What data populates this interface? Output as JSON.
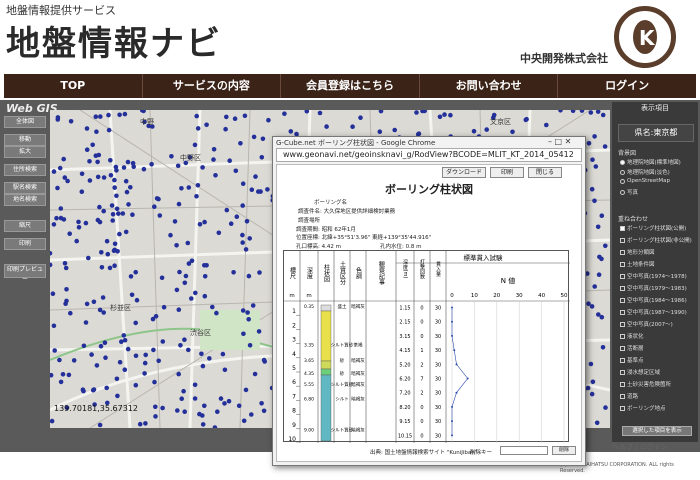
{
  "header": {
    "subtitle": "地盤情報提供サービス",
    "title": "地盤情報ナビ",
    "company": "中央開発株式会社"
  },
  "nav": {
    "items": [
      "TOP",
      "サービスの内容",
      "会員登録はこちら",
      "お問い合わせ",
      "ログイン"
    ]
  },
  "app": {
    "label": "Web GIS",
    "left_buttons": [
      "全体図",
      "移動",
      "拡大",
      "住所検索",
      "駅名検索",
      "地名検索",
      "縮尺",
      "印刷",
      "印刷プレビュー"
    ],
    "coordinates": "139.70181,35.67312"
  },
  "right_panel": {
    "title": "表示項目",
    "prefecture": "県名:東京都",
    "base_map_section": "背景図",
    "base_map_options": [
      {
        "label": "地理院地図(標準地図)",
        "checked": true
      },
      {
        "label": "地理院地図(淡色)",
        "checked": false
      },
      {
        "label": "OpenStreetMap",
        "checked": false
      },
      {
        "label": "写真",
        "checked": false
      }
    ],
    "overlay_section": "重ね合わせ",
    "overlay_options": [
      {
        "label": "ボーリング柱状図(公開)",
        "checked": true
      },
      {
        "label": "ボーリング柱状図(非公開)",
        "checked": false
      },
      {
        "label": "地形分類図",
        "checked": false
      },
      {
        "label": "土地条件図",
        "checked": false
      },
      {
        "label": "空中写真(1974〜1978)",
        "checked": false
      },
      {
        "label": "空中写真(1979〜1983)",
        "checked": false
      },
      {
        "label": "空中写真(1984〜1986)",
        "checked": false
      },
      {
        "label": "空中写真(1987〜1990)",
        "checked": false
      },
      {
        "label": "空中写真(2007〜)",
        "checked": false
      },
      {
        "label": "液状化",
        "checked": false
      },
      {
        "label": "活断層",
        "checked": false
      },
      {
        "label": "基準点",
        "checked": false
      },
      {
        "label": "浸水想定区域",
        "checked": false
      },
      {
        "label": "土砂災害危険箇所",
        "checked": false
      },
      {
        "label": "道路",
        "checked": false
      },
      {
        "label": "ボーリング地点",
        "checked": false
      }
    ],
    "apply_button": "選択した項目を表示"
  },
  "bottom_links": "ヘルプ | ログイン",
  "copyright": "(c) CHUOKAIHATSU CORPORATION. ALL rights Reserved.",
  "popup": {
    "window_title": "G-Cube.net ボーリング柱状図 - Google Chrome",
    "url": "www.geonavi.net/geoinsknavi_g/RodView?BCODE=MLIT_KT_2014_05412",
    "doc_title": "ボーリング柱状図",
    "buttons": [
      "ダウンロード",
      "印刷",
      "閉じる"
    ],
    "meta": [
      "ボーリング名",
      "調査件名: 大久保地区提供詳細検討業務",
      "調査場所",
      "調査期間: 昭和 62年1月",
      "位置座標: 北緯+35°51'3.96\" 東経+139°35'44.916\"",
      "孔口標高: 4.42 m",
      "孔内水位: 0.8 m"
    ],
    "table": {
      "headers": [
        "標尺",
        "深度",
        "柱状図",
        "土質区分",
        "色調",
        "観察記事"
      ],
      "units": [
        "m",
        "m",
        "",
        "",
        "",
        ""
      ],
      "spt_header": "標準貫入試験",
      "spt_subheaders": [
        "深度(m)",
        "打撃回数",
        "貫入量"
      ],
      "n_value_label": "N 値",
      "n_axis": [
        "0",
        "10",
        "20",
        "30",
        "40",
        "50"
      ],
      "scale_labels": [
        "1",
        "2",
        "3",
        "4",
        "5",
        "6",
        "7",
        "8",
        "9",
        "10"
      ],
      "depth_labels": [
        "0.35",
        "3.35",
        "3.65",
        "4.35",
        "5.55",
        "6.80",
        "9.00"
      ],
      "soil_labels": [
        "盛土",
        "シルト質砂",
        "砂",
        "砂",
        "シルト質砂",
        "シルト",
        "シルト質砂"
      ],
      "color_labels": [
        "暗褐灰",
        "茶褐",
        "暗褐灰",
        "暗褐灰",
        "暗褐灰",
        "暗褐灰",
        "暗褐灰"
      ],
      "spt_depths": [
        "1.15",
        "2.15",
        "3.15",
        "4.15",
        "5.20",
        "6.20",
        "7.20",
        "8.20",
        "9.15",
        "10.15"
      ],
      "blows": [
        "0",
        "0",
        "0",
        "1",
        "2",
        "7",
        "2",
        "0",
        "0",
        "0"
      ],
      "penetration": [
        "30",
        "30",
        "30",
        "30",
        "30",
        "30",
        "30",
        "30",
        "30",
        "30"
      ]
    },
    "source": "出典: 国土地盤情報検索サイト \"KuniJiban\"",
    "delete_key_label": "削除キー",
    "delete_button": "削除"
  },
  "colors": {
    "nav_bg": "#3b2318",
    "logo": "#5a3d2a",
    "point_color": "#24309a",
    "column_yellow": "#e8e04a",
    "column_teal": "#5fb8c2"
  }
}
